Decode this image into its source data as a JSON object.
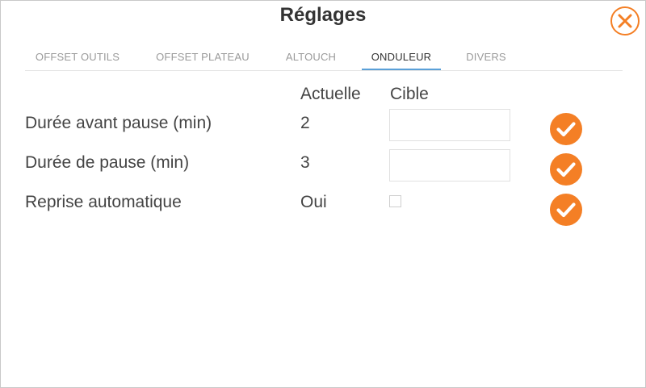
{
  "dialog": {
    "title": "Réglages"
  },
  "tabs": [
    {
      "label": "OFFSET OUTILS",
      "active": false
    },
    {
      "label": "OFFSET PLATEAU",
      "active": false
    },
    {
      "label": "ALTOUCH",
      "active": false
    },
    {
      "label": "ONDULEUR",
      "active": true
    },
    {
      "label": "DIVERS",
      "active": false
    }
  ],
  "columns": {
    "current": "Actuelle",
    "target": "Cible"
  },
  "rows": [
    {
      "label": "Durée avant pause (min)",
      "current": "2",
      "target": ""
    },
    {
      "label": "Durée de pause (min)",
      "current": "3",
      "target": ""
    },
    {
      "label": "Reprise automatique",
      "current": "Oui",
      "target_checked": false
    }
  ],
  "colors": {
    "accent": "#f47f25",
    "active_tab_underline": "#5aa0d8"
  },
  "icons": {
    "close": "close-icon",
    "apply": "checkmark-icon"
  }
}
